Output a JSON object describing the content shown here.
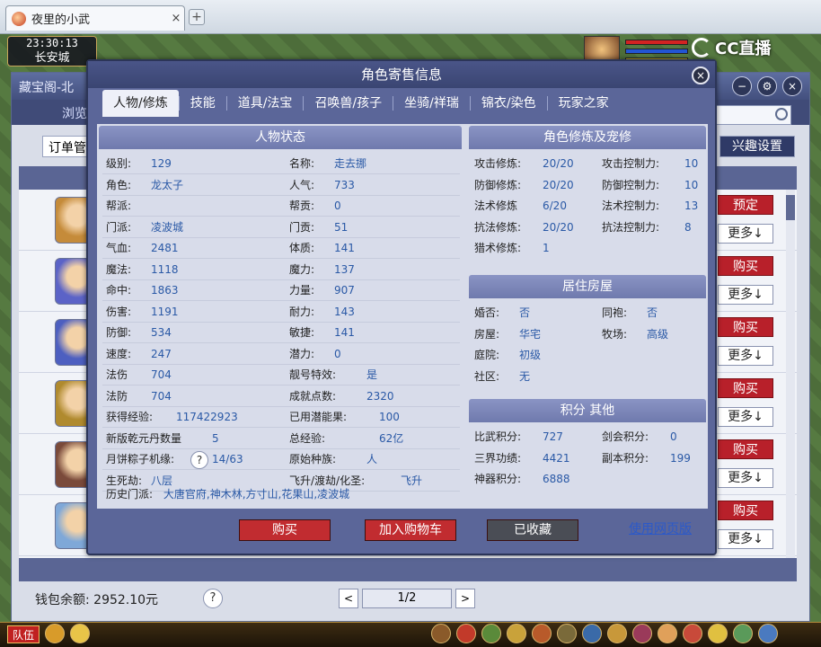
{
  "browser": {
    "tab_title": "夜里的小武",
    "tab_close": "×",
    "new_tab": "+"
  },
  "game": {
    "time": "23:30:13",
    "city": "长安城",
    "stream_logo": "CC直播"
  },
  "cbg": {
    "title": "藏宝阁-北",
    "nav_label": "浏览",
    "order_label": "订单管",
    "interest_label": "兴趣设置",
    "rows": [
      {
        "action": "预定",
        "more": "更多↓",
        "avatar_color": "#c58b3a"
      },
      {
        "action": "购买",
        "more": "更多↓",
        "avatar_color": "#5b63c7"
      },
      {
        "action": "购买",
        "more": "更多↓",
        "avatar_color": "#4d5fc0"
      },
      {
        "action": "购买",
        "more": "更多↓",
        "avatar_color": "#b08a2e"
      },
      {
        "action": "购买",
        "more": "更多↓",
        "avatar_color": "#7a4a3a"
      },
      {
        "action": "购买",
        "more": "更多↓",
        "avatar_color": "#7fa8d8"
      }
    ],
    "wallet": "钱包余额: 2952.10元",
    "help": "?",
    "pager": {
      "prev": "<",
      "page": "1/2",
      "next": ">"
    }
  },
  "modal": {
    "title": "角色寄售信息",
    "close": "×",
    "tabs": [
      "人物/修炼",
      "技能",
      "道具/法宝",
      "召唤兽/孩子",
      "坐骑/祥瑞",
      "锦衣/染色",
      "玩家之家"
    ],
    "status_title": "人物状态",
    "left_col": [
      {
        "k": "级别:",
        "v": "129"
      },
      {
        "k": "角色:",
        "v": "龙太子"
      },
      {
        "k": "帮派:",
        "v": ""
      },
      {
        "k": "门派:",
        "v": "凌波城"
      },
      {
        "k": "气血:",
        "v": "2481"
      },
      {
        "k": "魔法:",
        "v": "1118"
      },
      {
        "k": "命中:",
        "v": "1863"
      },
      {
        "k": "伤害:",
        "v": "1191"
      },
      {
        "k": "防御:",
        "v": "534"
      },
      {
        "k": "速度:",
        "v": "247"
      },
      {
        "k": "法伤",
        "v": "704"
      },
      {
        "k": "法防",
        "v": "704"
      },
      {
        "k": "获得经验:",
        "v": "117422923"
      },
      {
        "k": "新版乾元丹数量",
        "v": "5"
      },
      {
        "k": "月饼粽子机缘:",
        "v": "14/63"
      },
      {
        "k": "生死劫:",
        "v": "八层"
      }
    ],
    "right_col": [
      {
        "k": "名称:",
        "v": "走去挪"
      },
      {
        "k": "人气:",
        "v": "733"
      },
      {
        "k": "帮贡:",
        "v": "0"
      },
      {
        "k": "门贡:",
        "v": "51"
      },
      {
        "k": "体质:",
        "v": "141"
      },
      {
        "k": "魔力:",
        "v": "137"
      },
      {
        "k": "力量:",
        "v": "907"
      },
      {
        "k": "耐力:",
        "v": "143"
      },
      {
        "k": "敏捷:",
        "v": "141"
      },
      {
        "k": "潜力:",
        "v": "0"
      },
      {
        "k": "靓号特效:",
        "v": "是"
      },
      {
        "k": "成就点数:",
        "v": "2320"
      },
      {
        "k": "已用潜能果:",
        "v": "100"
      },
      {
        "k": "总经验:",
        "v": "62亿"
      },
      {
        "k": "原始种族:",
        "v": "人"
      },
      {
        "k": "飞升/渡劫/化圣:",
        "v": "飞升"
      }
    ],
    "history_label": "历史门派:",
    "history_value": "大唐官府,神木林,方寸山,花果山,凌波城",
    "question": "?",
    "cultivation_title": "角色修炼及宠修",
    "cultivation": [
      {
        "k": "攻击修炼:",
        "v": "20/20",
        "k2": "攻击控制力:",
        "v2": "10"
      },
      {
        "k": "防御修炼:",
        "v": "20/20",
        "k2": "防御控制力:",
        "v2": "10"
      },
      {
        "k": "法术修炼",
        "v": "6/20",
        "k2": "法术控制力:",
        "v2": "13"
      },
      {
        "k": "抗法修炼:",
        "v": "20/20",
        "k2": "抗法控制力:",
        "v2": "8"
      },
      {
        "k": "猎术修炼:",
        "v": "1",
        "k2": "",
        "v2": ""
      }
    ],
    "house_title": "居住房屋",
    "house": [
      {
        "k": "婚否:",
        "v": "否",
        "k2": "同袍:",
        "v2": "否"
      },
      {
        "k": "房屋:",
        "v": "华宅",
        "k2": "牧场:",
        "v2": "高级"
      },
      {
        "k": "庭院:",
        "v": "初级",
        "k2": "",
        "v2": ""
      },
      {
        "k": "社区:",
        "v": "无",
        "k2": "",
        "v2": ""
      }
    ],
    "score_title": "积分 其他",
    "scores": [
      {
        "k": "比武积分:",
        "v": "727",
        "k2": "剑会积分:",
        "v2": "0"
      },
      {
        "k": "三界功绩:",
        "v": "4421",
        "k2": "副本积分:",
        "v2": "199"
      },
      {
        "k": "神器积分:",
        "v": "6888",
        "k2": "",
        "v2": ""
      }
    ],
    "buttons": {
      "buy": "购买",
      "cart": "加入购物车",
      "collected": "已收藏",
      "web": "使用网页版"
    }
  },
  "toolbar": {
    "team": "队伍"
  }
}
